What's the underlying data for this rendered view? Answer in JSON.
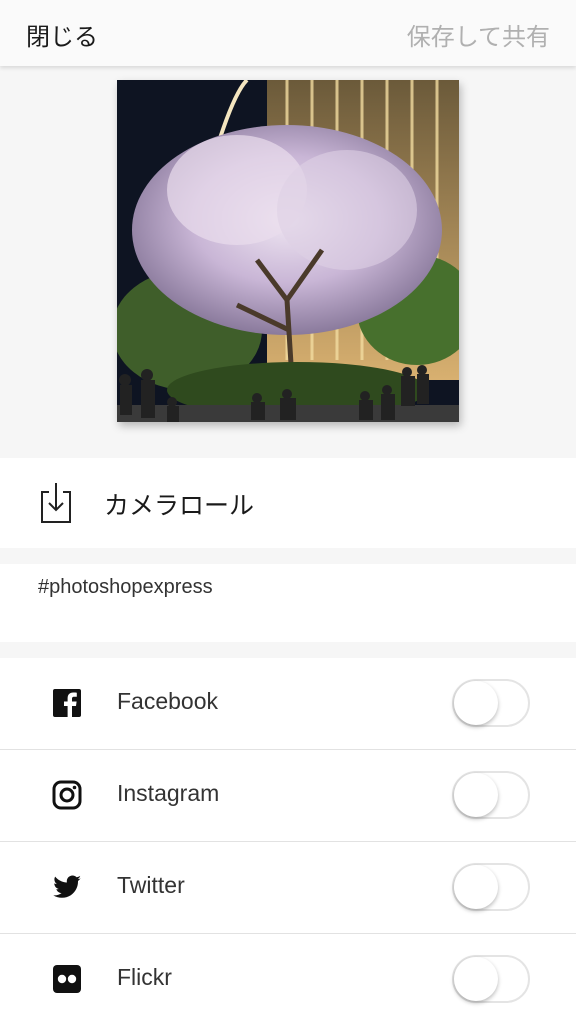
{
  "header": {
    "close_label": "閉じる",
    "save_label": "保存して共有"
  },
  "camera_roll": {
    "label": "カメラロール",
    "icon": "download-icon"
  },
  "caption": {
    "text": "#photoshopexpress"
  },
  "social": [
    {
      "label": "Facebook",
      "icon": "facebook-icon",
      "enabled": false
    },
    {
      "label": "Instagram",
      "icon": "instagram-icon",
      "enabled": false
    },
    {
      "label": "Twitter",
      "icon": "twitter-icon",
      "enabled": false
    },
    {
      "label": "Flickr",
      "icon": "flickr-icon",
      "enabled": false
    }
  ],
  "colors": {
    "save_disabled": "#b0b0b0",
    "background": "#f6f6f6"
  }
}
